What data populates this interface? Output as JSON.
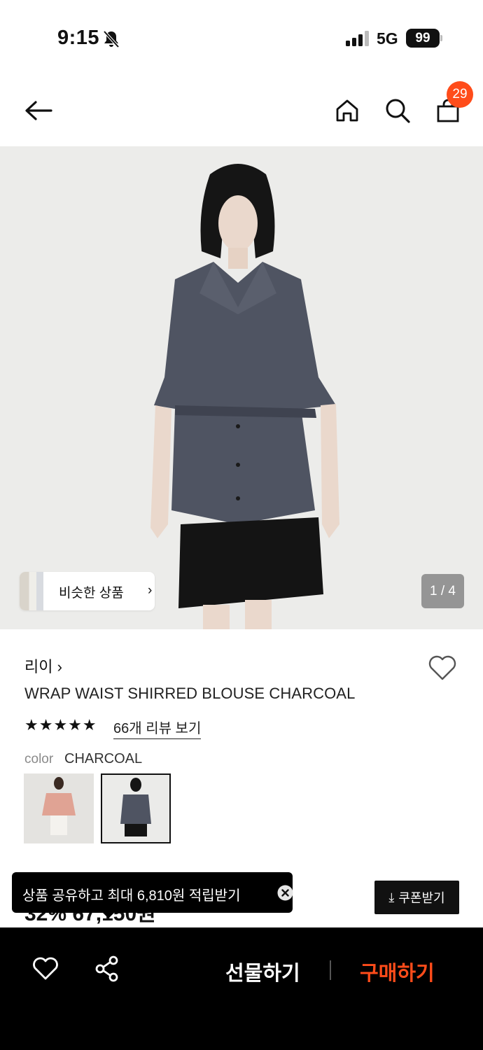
{
  "status_bar": {
    "time": "9:15",
    "network": "5G",
    "battery": "99"
  },
  "nav": {
    "cart_count": "29"
  },
  "gallery": {
    "similar_label": "비슷한 상품",
    "page_indicator": "1 / 4"
  },
  "product": {
    "brand": "리이",
    "title": "WRAP WAIST SHIRRED BLOUSE CHARCOAL",
    "rating_stars": "★★★★★",
    "review_link": "66개 리뷰 보기",
    "color_label": "color",
    "color_value": "CHARCOAL",
    "price_partial": "32% 67,150원"
  },
  "coupon": {
    "label": "쿠폰받기"
  },
  "tooltip": {
    "text": "상품 공유하고 최대 6,810원 적립받기"
  },
  "bottom_bar": {
    "gift_label": "선물하기",
    "buy_label": "구매하기"
  },
  "colors": {
    "accent": "#ff4c1a",
    "bar": "#000000"
  }
}
